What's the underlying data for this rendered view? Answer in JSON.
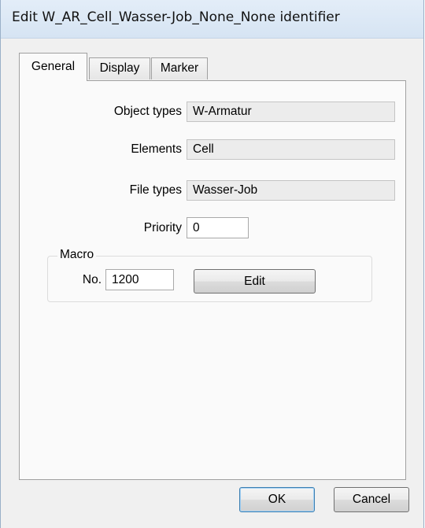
{
  "window": {
    "title": "Edit W_AR_Cell_Wasser-Job_None_None identifier"
  },
  "tabs": [
    {
      "label": "General",
      "active": true
    },
    {
      "label": "Display",
      "active": false
    },
    {
      "label": "Marker",
      "active": false
    }
  ],
  "general": {
    "object_types_label": "Object types",
    "object_types_value": "W-Armatur",
    "elements_label": "Elements",
    "elements_value": "Cell",
    "file_types_label": "File types",
    "file_types_value": "Wasser-Job",
    "priority_label": "Priority",
    "priority_value": "0"
  },
  "macro": {
    "group_label": "Macro",
    "no_label": "No.",
    "no_value": "1200",
    "edit_label": "Edit"
  },
  "footer": {
    "ok_label": "OK",
    "cancel_label": "Cancel"
  }
}
